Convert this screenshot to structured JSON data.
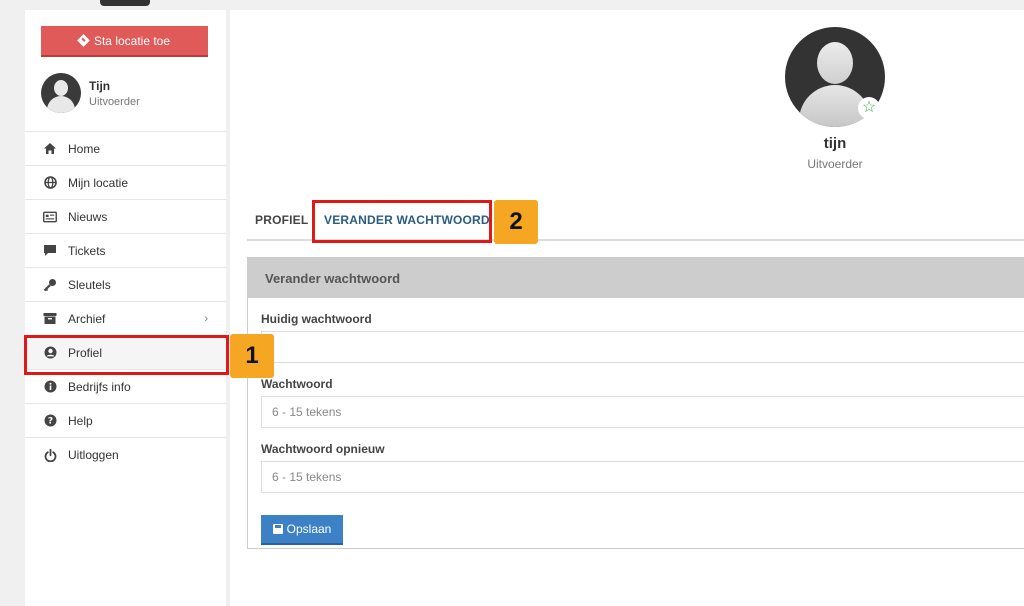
{
  "sidebar": {
    "location_button": "Sta locatie toe",
    "user": {
      "name": "Tijn",
      "role": "Uitvoerder"
    },
    "items": [
      {
        "label": "Home",
        "icon": "home-icon"
      },
      {
        "label": "Mijn locatie",
        "icon": "globe-icon"
      },
      {
        "label": "Nieuws",
        "icon": "newspaper-icon"
      },
      {
        "label": "Tickets",
        "icon": "chat-icon"
      },
      {
        "label": "Sleutels",
        "icon": "key-icon"
      },
      {
        "label": "Archief",
        "icon": "archive-icon"
      },
      {
        "label": "Profiel",
        "icon": "user-circle-icon"
      },
      {
        "label": "Bedrijfs info",
        "icon": "info-icon"
      },
      {
        "label": "Help",
        "icon": "question-icon"
      },
      {
        "label": "Uitloggen",
        "icon": "power-icon"
      }
    ]
  },
  "annotations": {
    "step1": "1",
    "step2": "2"
  },
  "profile": {
    "name": "tijn",
    "role": "Uitvoerder"
  },
  "tabs": {
    "profiel": "PROFIEL",
    "verander": "VERANDER WACHTWOORD"
  },
  "panel": {
    "title": "Verander wachtwoord",
    "current_label": "Huidig wachtwoord",
    "current_value": "",
    "new_label": "Wachtwoord",
    "new_placeholder": "6 - 15 tekens",
    "repeat_label": "Wachtwoord opnieuw",
    "repeat_placeholder": "6 - 15 tekens",
    "save": "Opslaan"
  },
  "colors": {
    "accent_red": "#e05a5a",
    "primary_blue": "#3c80c6",
    "highlight": "#e01818",
    "badge": "#f5a623",
    "star": "#3cb043"
  }
}
